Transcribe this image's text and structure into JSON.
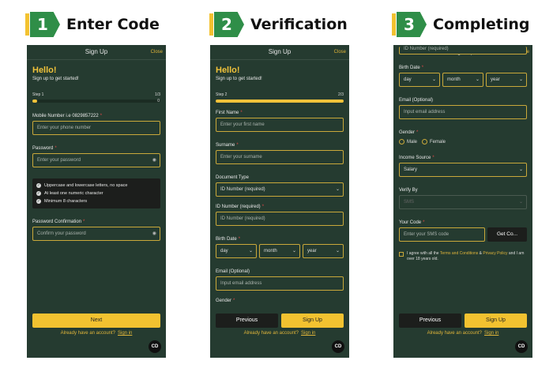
{
  "steps": [
    {
      "number": "1",
      "title": "Enter Code"
    },
    {
      "number": "2",
      "title": "Verification"
    },
    {
      "number": "3",
      "title": "Completing"
    }
  ],
  "header": {
    "title": "Sign Up",
    "close": "Close"
  },
  "common": {
    "hello": "Hello!",
    "subtitle": "Sign up to get started!",
    "have_account": "Already have an account?",
    "sign_in": "Sign in",
    "fab": "CD"
  },
  "screen1": {
    "step_label": "Step 1",
    "step_count": "1/3",
    "progress_fraction": 0.02,
    "mobile_label": "Mobile Number i.e 0829857222",
    "mobile_placeholder": "Enter your phone number",
    "password_label": "Password",
    "password_placeholder": "Enter your password",
    "rules": [
      "Uppercase and lowercase letters, no space",
      "At least one numeric character",
      "Minimum 8 characters"
    ],
    "confirm_label": "Password Confirmation",
    "confirm_placeholder": "Confirm your password",
    "next_button": "Next",
    "progress_end": "0"
  },
  "screen2": {
    "step_label": "Step 2",
    "step_count": "2/3",
    "progress_fraction": 1.0,
    "first_name_label": "First Name",
    "first_name_placeholder": "Enter your first name",
    "surname_label": "Surname",
    "surname_placeholder": "Enter your surname",
    "doc_type_label": "Document Type",
    "doc_type_value": "ID Number (required)",
    "id_label": "ID Number (required)",
    "id_placeholder": "ID Number (required)",
    "birth_label": "Birth Date",
    "day": "day",
    "month": "month",
    "year": "year",
    "email_label": "Email (Optional)",
    "email_placeholder": "Input email address",
    "gender_label": "Gender",
    "previous_button": "Previous",
    "signup_button": "Sign Up"
  },
  "screen3": {
    "top_field_partial": "ID Number (required)",
    "birth_label": "Birth Date",
    "day": "day",
    "month": "month",
    "year": "year",
    "email_label": "Email (Optional)",
    "email_placeholder": "Input email address",
    "gender_label": "Gender",
    "male": "Male",
    "female": "Female",
    "income_label": "Income Source",
    "income_value": "Salary",
    "verify_label": "Verify By",
    "verify_value": "SMS",
    "code_label": "Your Code",
    "code_placeholder": "Enter your SMS code",
    "get_code": "Get Co...",
    "agree_prefix": "I agree with all the",
    "terms": "Terms and Conditions",
    "amp": "&",
    "privacy": "Privacy Policy",
    "agree_suffix": "and I am over 18 years old.",
    "previous_button": "Previous",
    "signup_button": "Sign Up"
  }
}
